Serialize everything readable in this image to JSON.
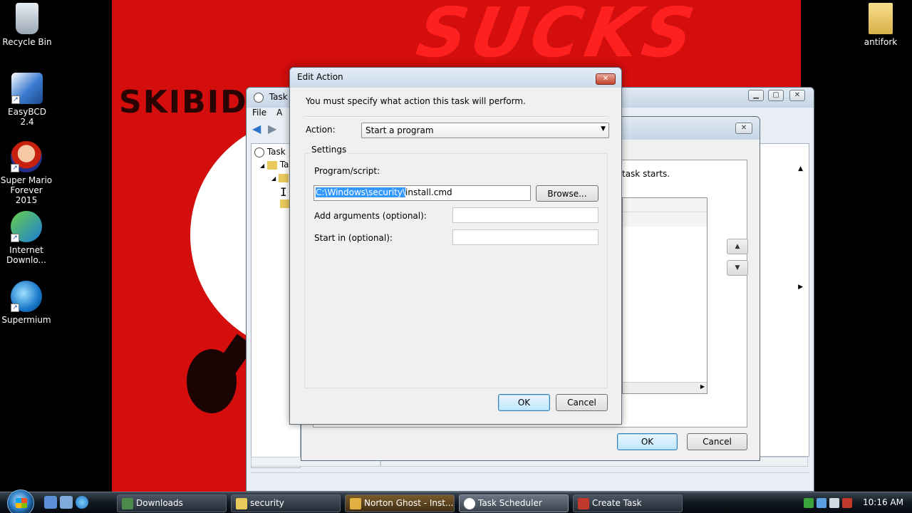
{
  "desktop": {
    "icons": [
      {
        "label": "Recycle Bin"
      },
      {
        "label": "EasyBCD 2.4"
      },
      {
        "label": "Super Mario Forever 2015"
      },
      {
        "label": "Internet Downlo..."
      },
      {
        "label": "Supermium"
      },
      {
        "label": "antifork"
      }
    ],
    "wallpaper_text_top": "SUCKS",
    "wallpaper_text_left": "SKIBIDI"
  },
  "task_scheduler": {
    "title": "Task S",
    "menu": [
      "File",
      "A"
    ],
    "tree": [
      {
        "label": "Task"
      },
      {
        "label": "Ta"
      }
    ]
  },
  "create_task": {
    "description_fragment": "task starts.",
    "ok_label": "OK",
    "cancel_label": "Cancel"
  },
  "edit_action": {
    "title": "Edit Action",
    "instruction": "You must specify what action this task will perform.",
    "action_label": "Action:",
    "action_value": "Start a program",
    "settings_legend": "Settings",
    "program_label": "Program/script:",
    "program_value_selected": "C:\\Windows\\security\\",
    "program_value_rest": "install.cmd",
    "browse_label": "Browse...",
    "args_label": "Add arguments (optional):",
    "start_in_label": "Start in (optional):",
    "ok_label": "OK",
    "cancel_label": "Cancel"
  },
  "taskbar": {
    "buttons": [
      {
        "label": "Downloads"
      },
      {
        "label": "security"
      },
      {
        "label": "Norton Ghost - Inst..."
      },
      {
        "label": "Task Scheduler"
      },
      {
        "label": "Create Task"
      }
    ],
    "clock": "10:16 AM"
  },
  "colors": {
    "wallpaper_red": "#d40d0d",
    "selection_blue": "#3399ff"
  }
}
